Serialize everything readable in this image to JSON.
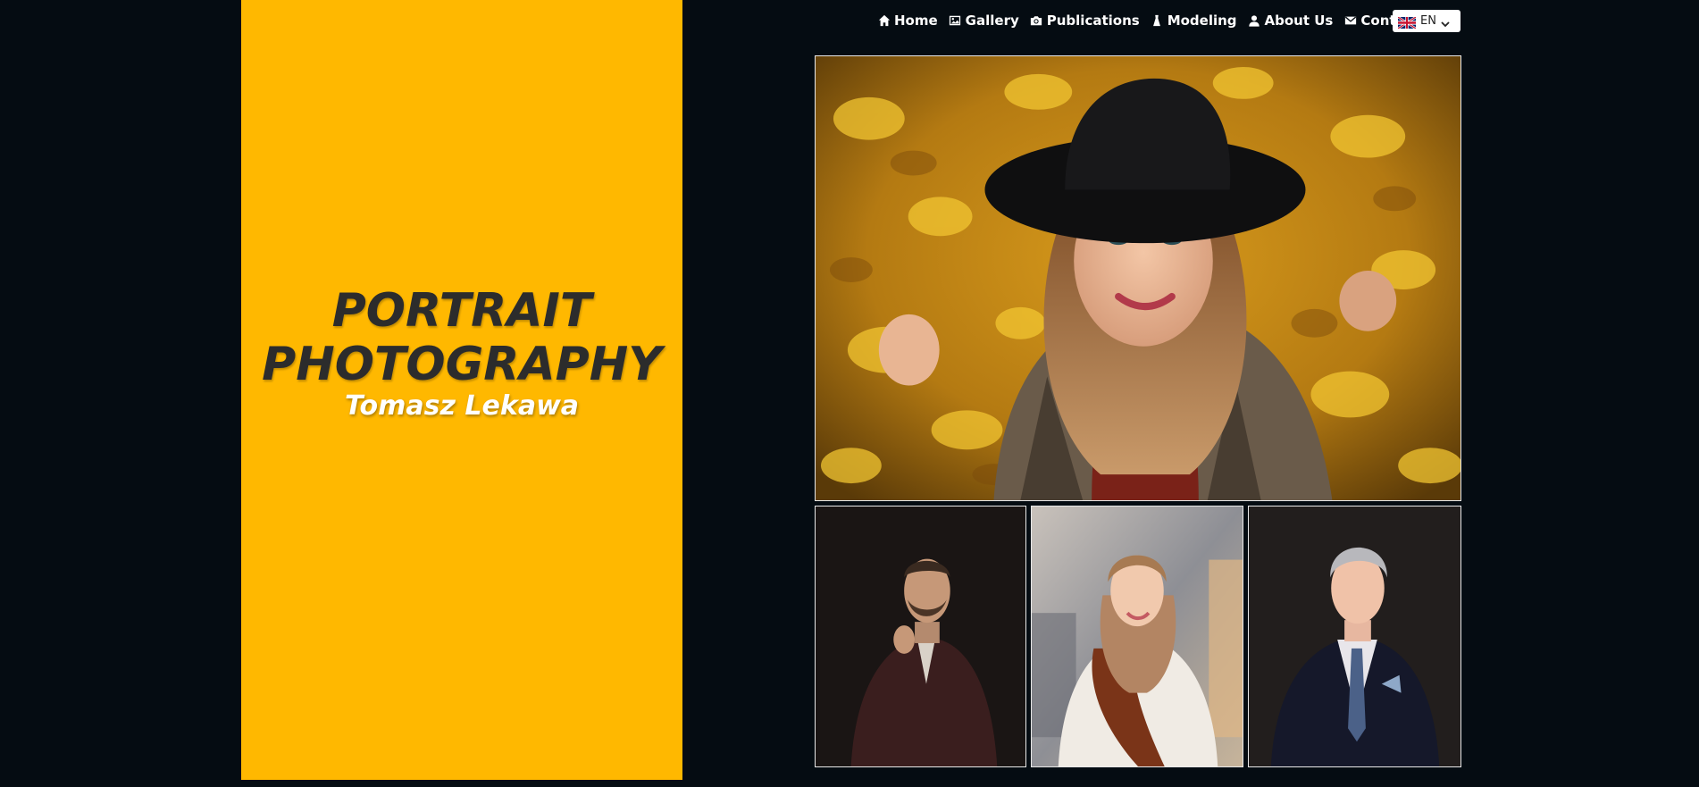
{
  "hero": {
    "title_line1": "PORTRAIT",
    "title_line2": "PHOTOGRAPHY",
    "subtitle": "Tomasz Lekawa",
    "panel_color": "#ffb800"
  },
  "nav": {
    "items": [
      {
        "label": "Home",
        "icon": "home-icon"
      },
      {
        "label": "Gallery",
        "icon": "image-icon"
      },
      {
        "label": "Publications",
        "icon": "camera-icon"
      },
      {
        "label": "Modeling",
        "icon": "dress-icon"
      },
      {
        "label": "About Us",
        "icon": "user-icon"
      },
      {
        "label": "Contact",
        "icon": "envelope-icon"
      }
    ]
  },
  "language": {
    "selected": "EN",
    "flag": "uk-flag-icon"
  },
  "photos": {
    "main": "woman-in-black-hat-autumn-leaves",
    "thumbnails": [
      "man-in-burgundy-suit",
      "woman-in-white-sweater-scarf",
      "man-in-navy-suit"
    ]
  },
  "colors": {
    "background": "#050c12",
    "accent": "#ffb800",
    "nav_text": "#ffffff"
  }
}
